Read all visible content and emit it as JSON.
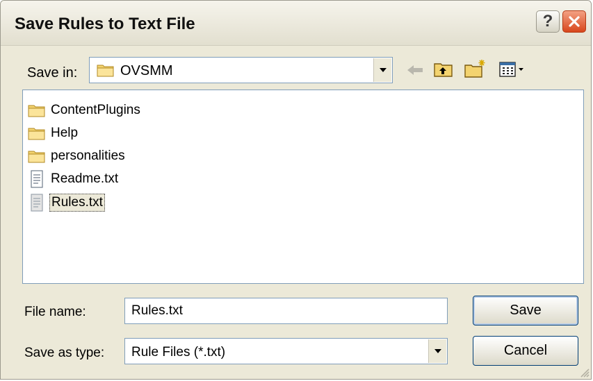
{
  "dialog": {
    "title": "Save Rules to Text File",
    "help_glyph": "?"
  },
  "save_in": {
    "label": "Save in:",
    "value": "OVSMM"
  },
  "toolbar": {
    "icons": [
      "back-arrow-icon",
      "up-one-level-icon",
      "create-new-folder-icon",
      "view-menu-icon"
    ]
  },
  "files": [
    {
      "name": "ContentPlugins",
      "type": "folder"
    },
    {
      "name": "Help",
      "type": "folder"
    },
    {
      "name": "personalities",
      "type": "folder"
    },
    {
      "name": "Readme.txt",
      "type": "text-file"
    },
    {
      "name": "Rules.txt",
      "type": "text-file",
      "selected": true
    }
  ],
  "file_name": {
    "label": "File name:",
    "value": "Rules.txt"
  },
  "save_as_type": {
    "label": "Save as type:",
    "value": "Rule Files (*.txt)"
  },
  "buttons": {
    "save": "Save",
    "cancel": "Cancel"
  },
  "colors": {
    "dialog_bg": "#ece9d8",
    "field_border": "#7f9db9",
    "close_button": "#d8461c"
  }
}
